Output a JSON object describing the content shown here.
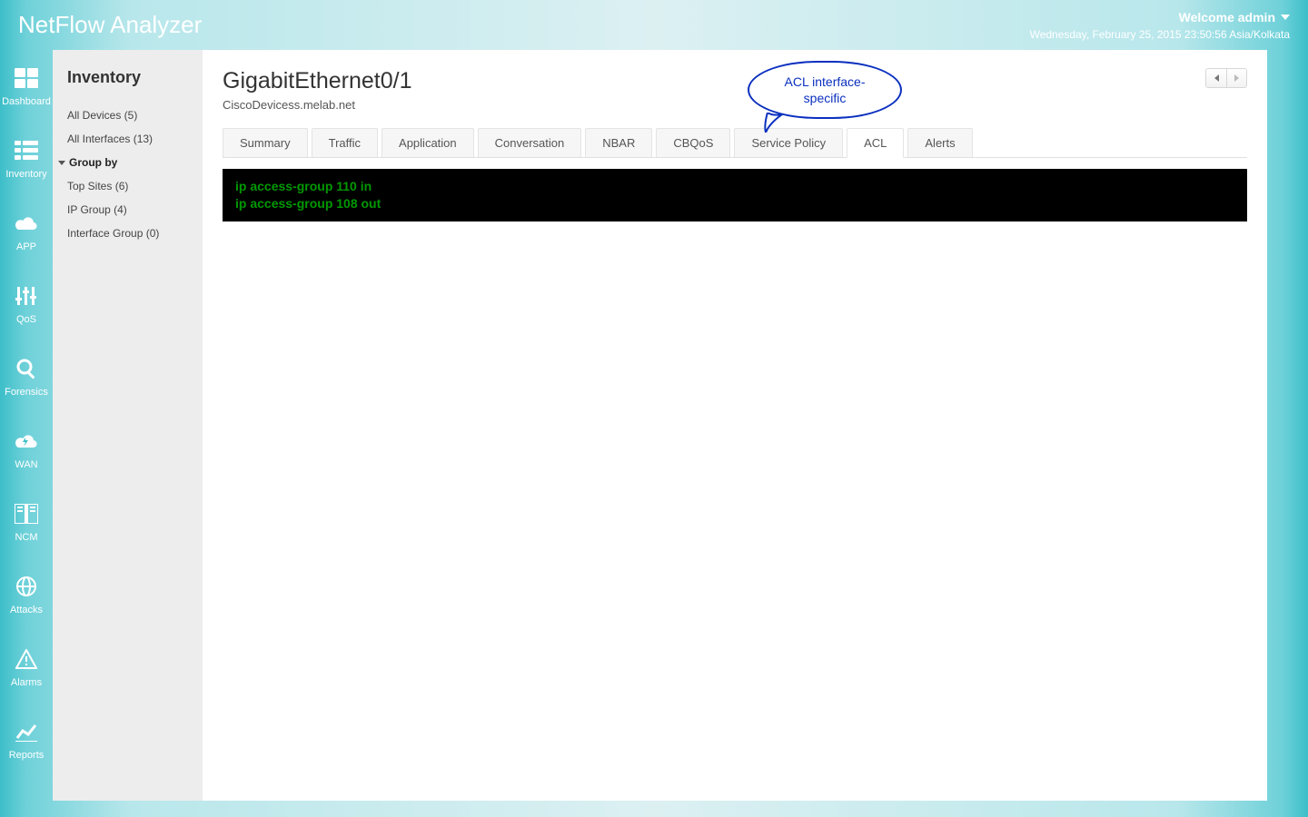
{
  "app_title": "NetFlow Analyzer",
  "header": {
    "welcome": "Welcome admin",
    "timestamp": "Wednesday, February 25, 2015 23:50:56 Asia/Kolkata"
  },
  "sidebar": {
    "items": [
      {
        "label": "Dashboard"
      },
      {
        "label": "Inventory"
      },
      {
        "label": "APP"
      },
      {
        "label": "QoS"
      },
      {
        "label": "Forensics"
      },
      {
        "label": "WAN"
      },
      {
        "label": "NCM"
      },
      {
        "label": "Attacks"
      },
      {
        "label": "Alarms"
      },
      {
        "label": "Reports"
      }
    ]
  },
  "inventory": {
    "heading": "Inventory",
    "all_devices": "All Devices (5)",
    "all_interfaces": "All Interfaces (13)",
    "group_by": "Group by",
    "top_sites": "Top Sites (6)",
    "ip_group": "IP Group (4)",
    "interface_group": "Interface Group (0)"
  },
  "page": {
    "title": "GigabitEthernet0/1",
    "subtitle": "CiscoDevicess.melab.net"
  },
  "tabs": {
    "items": [
      {
        "label": "Summary"
      },
      {
        "label": "Traffic"
      },
      {
        "label": "Application"
      },
      {
        "label": "Conversation"
      },
      {
        "label": "NBAR"
      },
      {
        "label": "CBQoS"
      },
      {
        "label": "Service Policy"
      },
      {
        "label": "ACL"
      },
      {
        "label": "Alerts"
      }
    ],
    "active": 7
  },
  "acl": {
    "line1": "ip access-group 110 in",
    "line2": "ip access-group 108 out"
  },
  "callout": {
    "line1": "ACL  interface-",
    "line2": "specific"
  }
}
